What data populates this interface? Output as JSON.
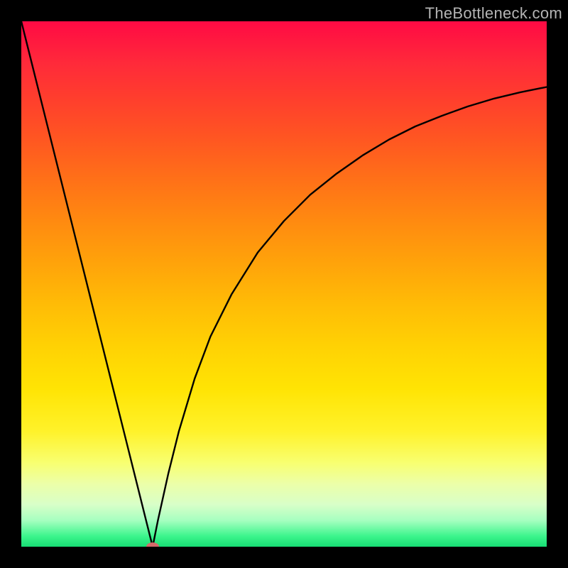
{
  "watermark": "TheBottleneck.com",
  "chart_data": {
    "type": "line",
    "title": "",
    "xlabel": "",
    "ylabel": "",
    "xlim": [
      0,
      100
    ],
    "ylim": [
      0,
      100
    ],
    "grid": false,
    "series": [
      {
        "name": "bottleneck-curve",
        "x": [
          0,
          5,
          10,
          15,
          20,
          22,
          24,
          25,
          26,
          28,
          30,
          33,
          36,
          40,
          45,
          50,
          55,
          60,
          65,
          70,
          75,
          80,
          85,
          90,
          95,
          100
        ],
        "values": [
          100,
          80,
          60,
          40,
          20,
          12,
          4,
          0,
          5,
          14,
          22,
          32,
          40,
          48,
          56,
          62,
          67,
          71,
          74.5,
          77.5,
          80,
          82,
          83.8,
          85.3,
          86.5,
          87.5
        ]
      }
    ],
    "annotations": [
      {
        "name": "min-point",
        "x": 25,
        "y": 0
      }
    ],
    "colors": {
      "curve": "#000000",
      "marker": "#d46a6a",
      "gradient_top": "#ff0a44",
      "gradient_mid": "#ffd204",
      "gradient_bottom": "#17dd74"
    }
  }
}
